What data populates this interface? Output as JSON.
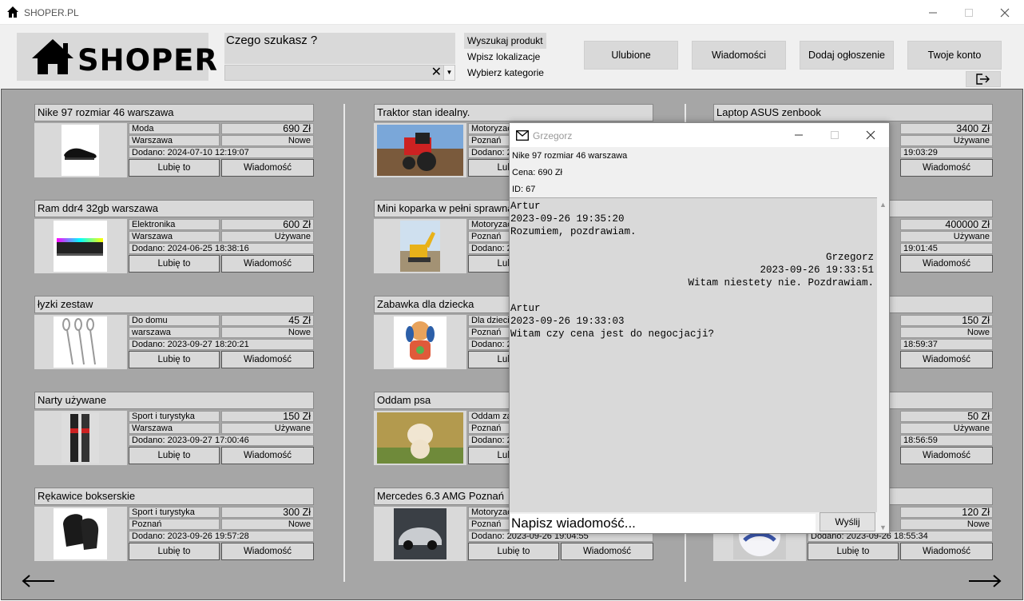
{
  "window": {
    "title": "SHOPER.PL"
  },
  "header": {
    "logo": "SHOPER",
    "search_question": "Czego szukasz ?",
    "search_value": "",
    "links": [
      "Wyszukaj produkt",
      "Wpisz lokalizacje",
      "Wybierz kategorie"
    ],
    "buttons": {
      "favorites": "Ulubione",
      "messages": "Wiadomości",
      "add_listing": "Dodaj ogłoszenie",
      "account": "Twoje konto"
    }
  },
  "labels": {
    "like": "Lubię to",
    "message": "Wiadomość"
  },
  "columns": [
    [
      {
        "title": "Nike 97 rozmiar 46 warszawa",
        "category": "Moda",
        "price": "690 Zł",
        "location": "Warszawa",
        "condition": "Nowe",
        "date": "Dodano: 2024-07-10 12:19:07",
        "image": "sneaker-icon"
      },
      {
        "title": "Ram ddr4 32gb warszawa",
        "category": "Elektronika",
        "price": "600 Zł",
        "location": "Warszawa",
        "condition": "Używane",
        "date": "Dodano: 2024-06-25 18:38:16",
        "image": "ram-icon"
      },
      {
        "title": "łyzki zestaw",
        "category": "Do domu",
        "price": "45 Zł",
        "location": "warszawa",
        "condition": "Nowe",
        "date": "Dodano: 2023-09-27 18:20:21",
        "image": "spoons-icon"
      },
      {
        "title": "Narty używane",
        "category": "Sport i turystyka",
        "price": "150 Zł",
        "location": "Warszawa",
        "condition": "Używane",
        "date": "Dodano: 2023-09-27 17:00:46",
        "image": "skis-icon"
      },
      {
        "title": "Rękawice bokserskie",
        "category": "Sport i turystyka",
        "price": "300 Zł",
        "location": "Poznań",
        "condition": "Nowe",
        "date": "Dodano: 2023-09-26 19:57:28",
        "image": "boxing-glove-icon"
      }
    ],
    [
      {
        "title": "Traktor stan idealny.",
        "category": "Motoryzacja",
        "price": "",
        "location": "Poznań",
        "condition": "",
        "date": "Dodano: 2",
        "image": "tractor-icon"
      },
      {
        "title": "Mini koparka w pełni sprawna",
        "category": "Motoryzacja",
        "price": "",
        "location": "Poznań",
        "condition": "",
        "date": "Dodano: 2",
        "image": "excavator-icon"
      },
      {
        "title": "Zabawka dla dziecka",
        "category": "Dla dzieci",
        "price": "",
        "location": "Poznań",
        "condition": "",
        "date": "Dodano: 2",
        "image": "toy-dog-icon"
      },
      {
        "title": "Oddam psa",
        "category": "Oddam za",
        "price": "",
        "location": "Poznań",
        "condition": "",
        "date": "Dodano: 2",
        "image": "puppy-icon"
      },
      {
        "title": "Mercedes 6.3 AMG Poznań",
        "category": "Motoryzacja",
        "price": "",
        "location": "Poznań",
        "condition": "",
        "date": "Dodano: 2023-09-26 19:04:55",
        "image": "car-icon"
      }
    ],
    [
      {
        "title": "Laptop ASUS zenbook",
        "category": "",
        "price": "3400 Zł",
        "location": "",
        "condition": "Używane",
        "date": "19:03:29",
        "image": ""
      },
      {
        "title": "",
        "category": "",
        "price": "400000 Zł",
        "location": "",
        "condition": "Używane",
        "date": "19:01:45",
        "image": ""
      },
      {
        "title": "",
        "category": "",
        "price": "150 Zł",
        "location": "",
        "condition": "Nowe",
        "date": "18:59:37",
        "image": ""
      },
      {
        "title": "",
        "category": "",
        "price": "50 Zł",
        "location": "",
        "condition": "Używane",
        "date": "18:56:59",
        "image": ""
      },
      {
        "title": "",
        "category": "",
        "price": "120 Zł",
        "location": "",
        "condition": "Nowe",
        "date": "Dodano: 2023-09-26 18:55:34",
        "image": "ball-icon"
      }
    ]
  ],
  "chat": {
    "window_title": "Grzegorz",
    "product": "Nike 97 rozmiar 46 warszawa",
    "price": "Cena: 690 Zł",
    "id": "ID: 67",
    "messages": [
      {
        "author": "Artur",
        "time": "2023-09-26 19:35:20",
        "text": "Rozumiem, pozdrawiam.",
        "align": "left"
      },
      {
        "author": "Grzegorz",
        "time": "2023-09-26 19:33:51",
        "text": "Witam niestety nie. Pozdrawiam.",
        "align": "right"
      },
      {
        "author": "Artur",
        "time": "2023-09-26 19:33:03",
        "text": "Witam czy cena jest do negocjacji?",
        "align": "left"
      }
    ],
    "input_placeholder": "Napisz wiadomość...",
    "send_label": "Wyślij"
  }
}
